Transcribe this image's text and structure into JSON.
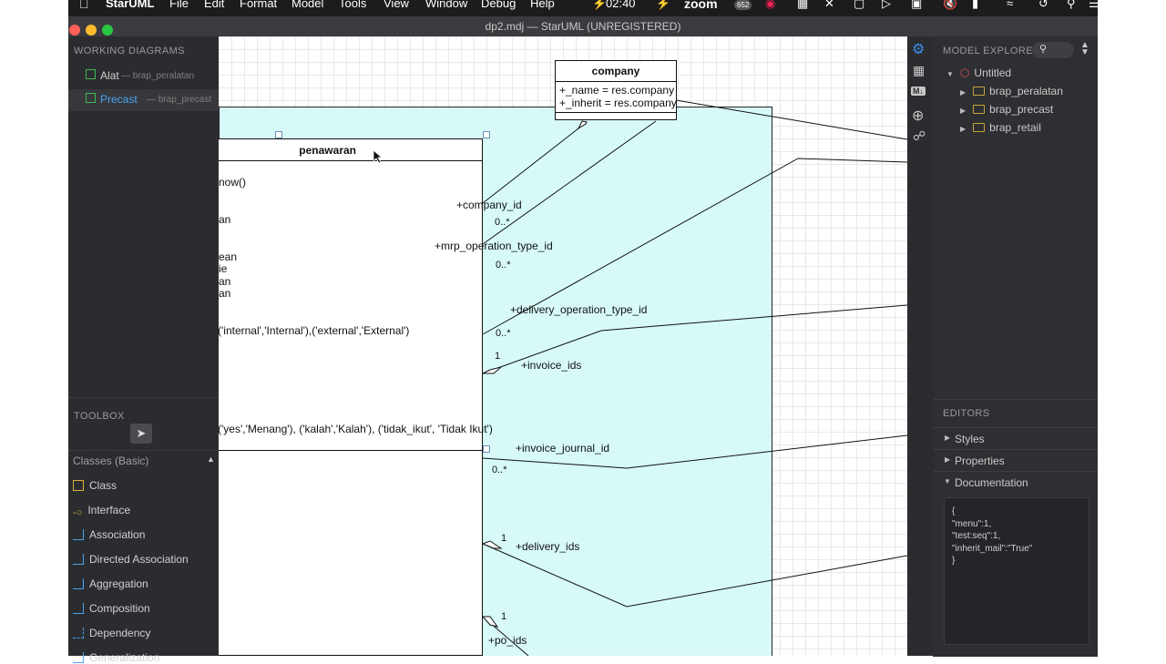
{
  "menubar": {
    "app": "StarUML",
    "items": [
      "File",
      "Edit",
      "Format",
      "Model",
      "Tools",
      "View",
      "Window",
      "Debug",
      "Help"
    ],
    "clock": "02:40",
    "zoom": "zoom",
    "badge": "652"
  },
  "window": {
    "title": "dp2.mdj — StarUML (UNREGISTERED)"
  },
  "working_diagrams": {
    "heading": "WORKING DIAGRAMS",
    "items": [
      {
        "name": "Alat",
        "sub": "— brap_peralatan"
      },
      {
        "name": "Precast",
        "sub": "— brap_precast"
      }
    ]
  },
  "toolbox": {
    "heading": "TOOLBOX",
    "section": "Classes (Basic)",
    "items": [
      "Class",
      "Interface",
      "Association",
      "Directed Association",
      "Aggregation",
      "Composition",
      "Dependency",
      "Generalization"
    ]
  },
  "diagram": {
    "company": {
      "name": "company",
      "attrs": [
        "+_name = res.company",
        "+_inherit = res.company"
      ]
    },
    "penawaran": {
      "name": "penawaran",
      "lines": [
        "now()",
        "an",
        "ean",
        "ie",
        "an",
        "an",
        "('internal','Internal'),('external','External')",
        "('yes','Menang'), ('kalah','Kalah'), ('tidak_ikut', 'Tidak Ikut')"
      ]
    },
    "roles": [
      "+company_id",
      "+mrp_operation_type_id",
      "+delivery_operation_type_id",
      "+invoice_ids",
      "+invoice_journal_id",
      "+delivery_ids",
      "+po_ids"
    ],
    "multiplicities": [
      "0..*",
      "0..*",
      "0..*",
      "1",
      "0..*",
      "1",
      "1"
    ]
  },
  "explorer": {
    "heading": "MODEL EXPLORER",
    "root": "Untitled",
    "children": [
      "brap_peralatan",
      "brap_precast",
      "brap_retail"
    ]
  },
  "editors": {
    "heading": "EDITORS",
    "items": [
      "Styles",
      "Properties",
      "Documentation"
    ],
    "doc_text": "{\n\"menu\":1,\n\"test:seq\":1,\n\"inherit_mail\":\"True\"\n}"
  }
}
